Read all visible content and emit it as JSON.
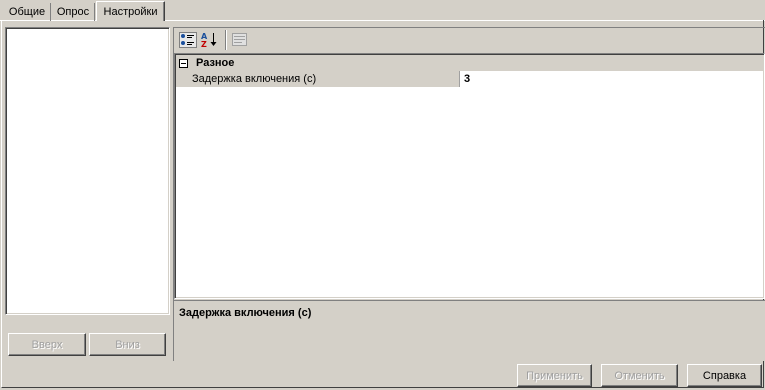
{
  "tabs": [
    {
      "label": "Общие"
    },
    {
      "label": "Опрос"
    },
    {
      "label": "Настройки"
    }
  ],
  "left_panel": {
    "up_button": "Вверх",
    "down_button": "Вниз"
  },
  "toolbar": {
    "categorized_icon": "categorized-view-icon",
    "alphabetical_icon": "sort-alphabetical-icon",
    "property_pages_icon": "property-pages-icon"
  },
  "property_grid": {
    "category": "Разное",
    "properties": [
      {
        "name": "Задержка включения (с)",
        "value": "3"
      }
    ]
  },
  "description": {
    "title": "Задержка включения (с)"
  },
  "footer": {
    "apply": "Применить",
    "cancel": "Отменить",
    "help": "Справка"
  }
}
